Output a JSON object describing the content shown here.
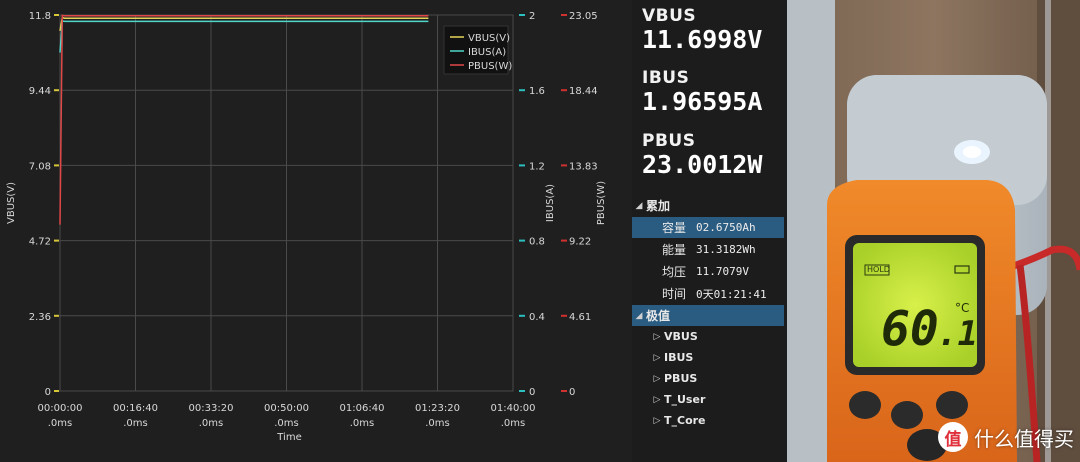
{
  "chart_data": {
    "type": "line",
    "xlabel": "Time",
    "x_ticks": [
      {
        "top": "00:00:00",
        "bottom": ".0ms"
      },
      {
        "top": "00:16:40",
        "bottom": ".0ms"
      },
      {
        "top": "00:33:20",
        "bottom": ".0ms"
      },
      {
        "top": "00:50:00",
        "bottom": ".0ms"
      },
      {
        "top": "01:06:40",
        "bottom": ".0ms"
      },
      {
        "top": "01:23:20",
        "bottom": ".0ms"
      },
      {
        "top": "01:40:00",
        "bottom": ".0ms"
      }
    ],
    "xlim_seconds": [
      0,
      6000
    ],
    "axes": [
      {
        "label": "VBUS(V)",
        "side": "left",
        "ticks": [
          "0",
          "2.36",
          "4.72",
          "7.08",
          "9.44",
          "11.8"
        ],
        "lim": [
          0,
          11.8
        ],
        "color": "#d8c63a"
      },
      {
        "label": "IBUS(A)",
        "side": "right",
        "ticks": [
          "0",
          "0.4",
          "0.8",
          "1.2",
          "1.6",
          "2"
        ],
        "lim": [
          0,
          2
        ],
        "color": "#2bbfbf"
      },
      {
        "label": "PBUS(W)",
        "side": "right",
        "ticks": [
          "0",
          "4.61",
          "9.22",
          "13.83",
          "18.44",
          "23.05"
        ],
        "lim": [
          0,
          23.05
        ],
        "color": "#d03030"
      }
    ],
    "series": [
      {
        "name": "VBUS(V)",
        "axis": 0,
        "color": "#e6d45a",
        "x": [
          0,
          30,
          60,
          4880
        ],
        "y": [
          11.3,
          11.72,
          11.7,
          11.7
        ]
      },
      {
        "name": "IBUS(A)",
        "axis": 1,
        "color": "#4fd6c8",
        "x": [
          0,
          30,
          60,
          4880
        ],
        "y": [
          1.8,
          1.968,
          1.966,
          1.966
        ]
      },
      {
        "name": "PBUS(W)",
        "axis": 2,
        "color": "#e04848",
        "x": [
          0,
          30,
          60,
          4880
        ],
        "y": [
          10.2,
          23.03,
          23.0,
          23.0
        ]
      }
    ],
    "legend_position": "top-right",
    "grid": true
  },
  "readout": {
    "vbus_label": "VBUS",
    "vbus_value": "11.6998V",
    "ibus_label": "IBUS",
    "ibus_value": "1.96595A",
    "pbus_label": "PBUS",
    "pbus_value": "23.0012W"
  },
  "tree": {
    "accumulate": {
      "title": "累加",
      "items": [
        {
          "label": "容量",
          "value": "02.6750Ah",
          "selected": true
        },
        {
          "label": "能量",
          "value": "31.3182Wh",
          "selected": false
        },
        {
          "label": "均压",
          "value": "11.7079V",
          "selected": false
        },
        {
          "label": "时间",
          "value": "0天01:21:41",
          "selected": false
        }
      ]
    },
    "extremes": {
      "title": "极值",
      "items": [
        "VBUS",
        "IBUS",
        "PBUS",
        "T_User",
        "T_Core"
      ]
    }
  },
  "photo": {
    "lcd_reading": "60.1",
    "lcd_unit": "°C",
    "lcd_hold": "HOLD",
    "watermark_badge": "值",
    "watermark_text": "什么值得买"
  }
}
